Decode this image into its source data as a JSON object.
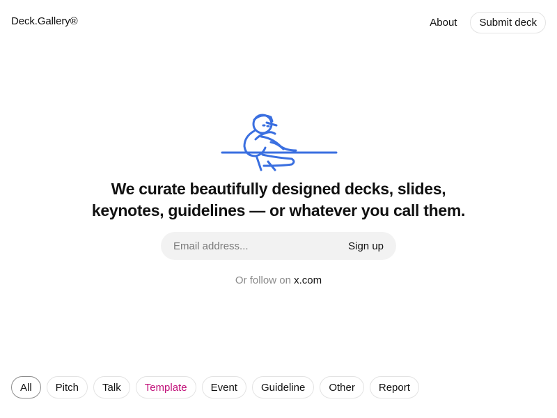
{
  "header": {
    "logo": "Deck.Gallery®",
    "nav_about": "About",
    "nav_submit": "Submit deck"
  },
  "hero": {
    "mascot_icon": "lounging-figure-illustration",
    "accent_color": "#3a6fe0",
    "headline_line1": "We curate beautifully designed decks, slides,",
    "headline_line2": "keynotes, guidelines — or whatever you call them.",
    "email_placeholder": "Email address...",
    "signup_label": "Sign up",
    "follow_prefix": "Or follow on",
    "follow_link": "x.com"
  },
  "filters": {
    "selected": "All",
    "highlight_color": "#c2127a",
    "items": [
      {
        "label": "All"
      },
      {
        "label": "Pitch"
      },
      {
        "label": "Talk"
      },
      {
        "label": "Template"
      },
      {
        "label": "Event"
      },
      {
        "label": "Guideline"
      },
      {
        "label": "Other"
      },
      {
        "label": "Report"
      }
    ]
  }
}
